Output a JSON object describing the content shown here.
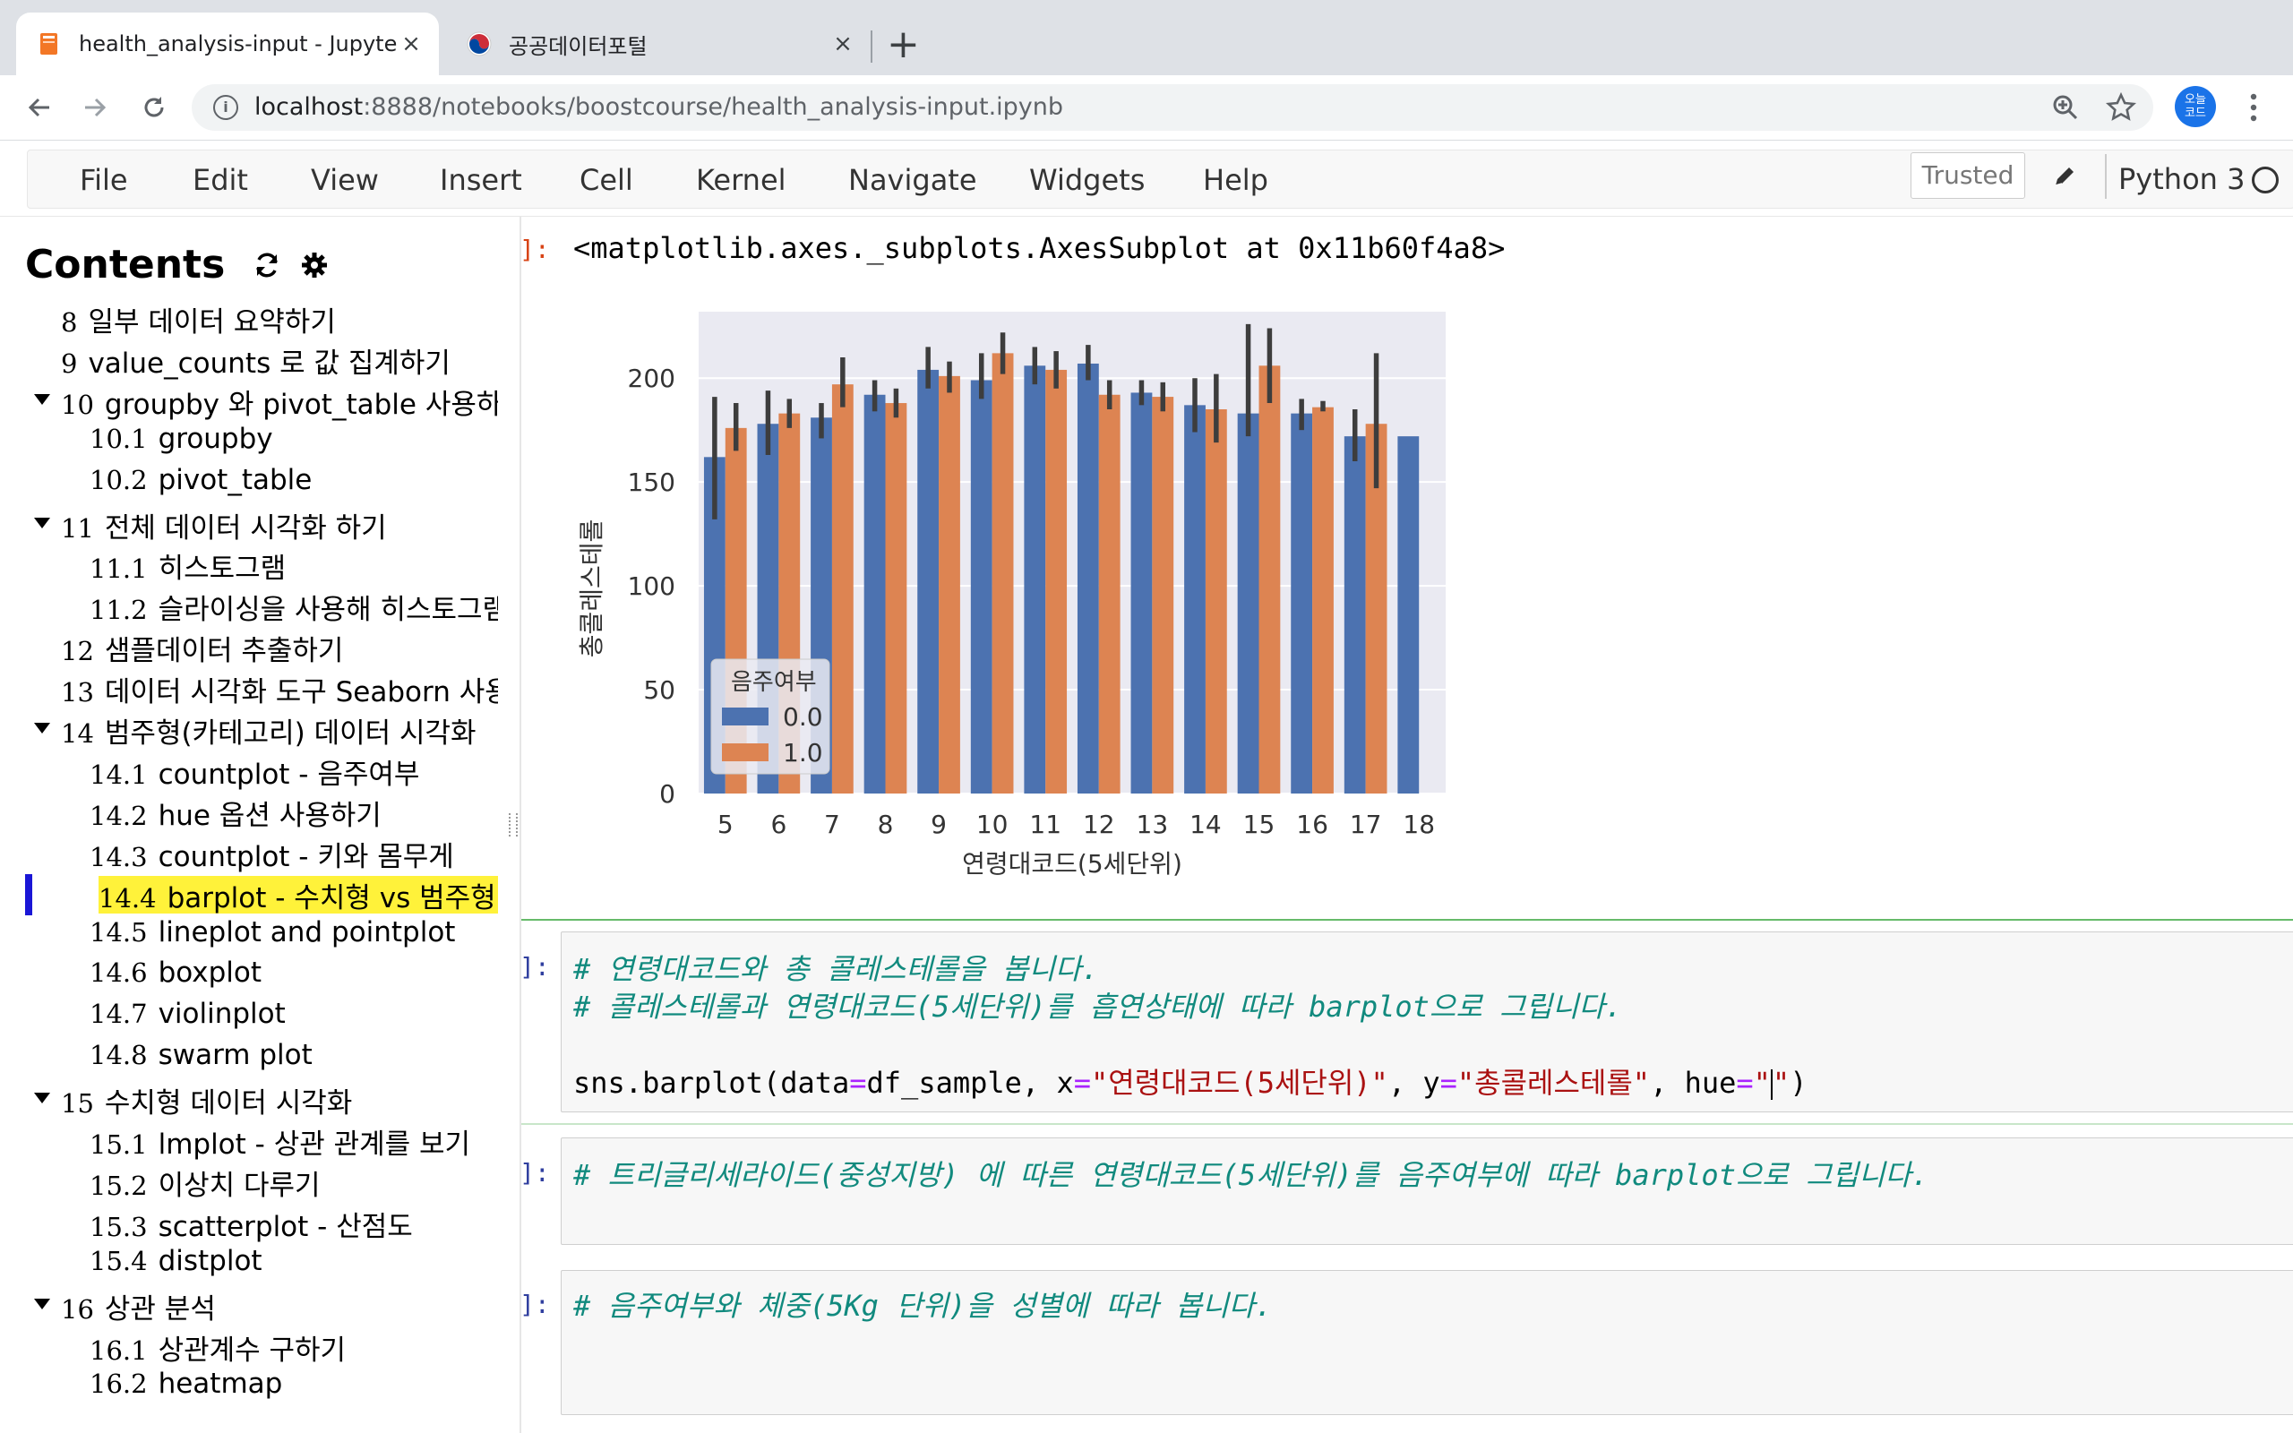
{
  "browser": {
    "tabs": [
      {
        "title": "health_analysis-input - Jupyter",
        "close": "×"
      },
      {
        "title": "공공데이터포털",
        "close": "×"
      }
    ],
    "new_tab": "+",
    "url_host": "localhost",
    "url_rest": ":8888/notebooks/boostcourse/health_analysis-input.ipynb",
    "profile_badge": "오늘코드"
  },
  "jupyter": {
    "menu": [
      "File",
      "Edit",
      "View",
      "Insert",
      "Cell",
      "Kernel",
      "Navigate",
      "Widgets",
      "Help"
    ],
    "trusted": "Trusted",
    "kernel": "Python 3"
  },
  "toc": {
    "title": "Contents",
    "items": [
      {
        "num": "8",
        "label": "일부 데이터 요약하기",
        "level": 1,
        "caret": false
      },
      {
        "num": "9",
        "label": "value_counts 로 값 집계하기",
        "level": 1,
        "caret": false
      },
      {
        "num": "10",
        "label": "groupby 와 pivot_table 사용하기",
        "level": 1,
        "caret": true
      },
      {
        "num": "10.1",
        "label": "groupby",
        "level": 2,
        "caret": false
      },
      {
        "num": "10.2",
        "label": "pivot_table",
        "level": 2,
        "caret": false
      },
      {
        "num": "11",
        "label": "전체 데이터 시각화 하기",
        "level": 1,
        "caret": true
      },
      {
        "num": "11.1",
        "label": "히스토그램",
        "level": 2,
        "caret": false
      },
      {
        "num": "11.2",
        "label": "슬라이싱을 사용해 히스토그램",
        "level": 2,
        "caret": false
      },
      {
        "num": "12",
        "label": "샘플데이터 추출하기",
        "level": 1,
        "caret": false
      },
      {
        "num": "13",
        "label": "데이터 시각화 도구 Seaborn 사용",
        "level": 1,
        "caret": false
      },
      {
        "num": "14",
        "label": "범주형(카테고리) 데이터 시각화",
        "level": 1,
        "caret": true
      },
      {
        "num": "14.1",
        "label": "countplot - 음주여부",
        "level": 2,
        "caret": false
      },
      {
        "num": "14.2",
        "label": "hue 옵션 사용하기",
        "level": 2,
        "caret": false
      },
      {
        "num": "14.3",
        "label": "countplot - 키와 몸무게",
        "level": 2,
        "caret": false
      },
      {
        "num": "14.4",
        "label": "barplot - 수치형 vs 범주형 데",
        "level": 2,
        "caret": false,
        "active": true
      },
      {
        "num": "14.5",
        "label": "lineplot and pointplot",
        "level": 2,
        "caret": false
      },
      {
        "num": "14.6",
        "label": "boxplot",
        "level": 2,
        "caret": false
      },
      {
        "num": "14.7",
        "label": "violinplot",
        "level": 2,
        "caret": false
      },
      {
        "num": "14.8",
        "label": "swarm plot",
        "level": 2,
        "caret": false
      },
      {
        "num": "15",
        "label": "수치형 데이터 시각화",
        "level": 1,
        "caret": true
      },
      {
        "num": "15.1",
        "label": "lmplot - 상관 관계를 보기",
        "level": 2,
        "caret": false
      },
      {
        "num": "15.2",
        "label": "이상치 다루기",
        "level": 2,
        "caret": false
      },
      {
        "num": "15.3",
        "label": "scatterplot - 산점도",
        "level": 2,
        "caret": false
      },
      {
        "num": "15.4",
        "label": "distplot",
        "level": 2,
        "caret": false
      },
      {
        "num": "16",
        "label": "상관 분석",
        "level": 1,
        "caret": true
      },
      {
        "num": "16.1",
        "label": "상관계수 구하기",
        "level": 2,
        "caret": false
      },
      {
        "num": "16.2",
        "label": "heatmap",
        "level": 2,
        "caret": false
      }
    ]
  },
  "cells": {
    "output_prompt": "]:",
    "output_text": "<matplotlib.axes._subplots.AxesSubplot at 0x11b60f4a8>",
    "cell1": {
      "prompt": "]:",
      "comment1": "# 연령대코드와 총 콜레스테롤을 봅니다.",
      "comment2": "# 콜레스테롤과 연령대코드(5세단위)를 흡연상태에 따라 barplot으로 그립니다.",
      "code_a": "sns.barplot(data",
      "code_eq1": "=",
      "code_b": "df_sample, x",
      "code_eq2": "=",
      "code_s1": "\"연령대코드(5세단위)\"",
      "code_c": ", y",
      "code_eq3": "=",
      "code_s2": "\"총콜레스테롤\"",
      "code_d": ", hue",
      "code_eq4": "=",
      "code_s3": "\"",
      "code_s4": "\"",
      "code_e": ")"
    },
    "cell2": {
      "prompt": "]:",
      "comment": "# 트리글리세라이드(중성지방) 에 따른 연령대코드(5세단위)를 음주여부에 따라 barplot으로 그립니다."
    },
    "cell3": {
      "prompt": "]:",
      "comment": "# 음주여부와 체중(5Kg 단위)을 성별에 따라 봅니다."
    }
  },
  "chart_data": {
    "type": "bar",
    "xlabel": "연령대코드(5세단위)",
    "ylabel": "총콜레스테롤",
    "categories": [
      "5",
      "6",
      "7",
      "8",
      "9",
      "10",
      "11",
      "12",
      "13",
      "14",
      "15",
      "16",
      "17",
      "18"
    ],
    "ylim": [
      0,
      232
    ],
    "yticks": [
      0,
      50,
      100,
      150,
      200
    ],
    "legend_title": "음주여부",
    "legend_position": "lower-left",
    "grid": true,
    "series": [
      {
        "name": "0.0",
        "color": "#4c72b0",
        "values": [
          162,
          178,
          181,
          192,
          204,
          199,
          206,
          207,
          193,
          187,
          183,
          183,
          172,
          172
        ],
        "err_low": [
          132,
          163,
          171,
          184,
          195,
          190,
          197,
          199,
          187,
          174,
          172,
          175,
          160,
          null
        ],
        "err_high": [
          191,
          194,
          188,
          199,
          215,
          212,
          215,
          216,
          199,
          200,
          226,
          190,
          185,
          null
        ]
      },
      {
        "name": "1.0",
        "color": "#dd8452",
        "values": [
          176,
          183,
          197,
          188,
          201,
          212,
          204,
          192,
          191,
          185,
          206,
          186,
          178,
          null
        ],
        "err_low": [
          165,
          176,
          186,
          181,
          193,
          202,
          195,
          185,
          184,
          169,
          188,
          184,
          147,
          null
        ],
        "err_high": [
          188,
          190,
          210,
          195,
          208,
          222,
          213,
          199,
          198,
          202,
          224,
          189,
          212,
          null
        ]
      }
    ]
  }
}
